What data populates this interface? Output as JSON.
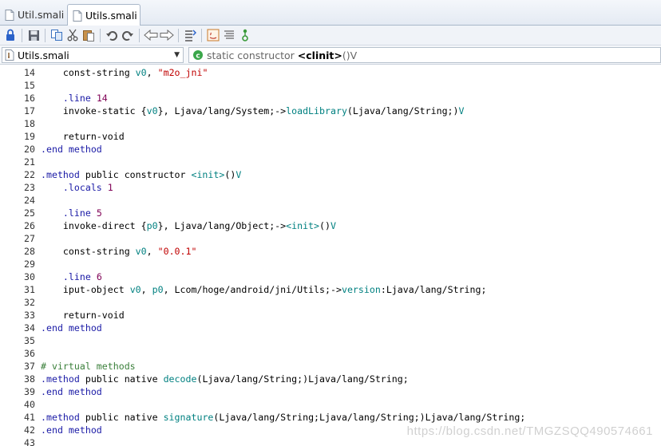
{
  "tabs": [
    {
      "label": "Util.smali",
      "active": false
    },
    {
      "label": "Utils.smali",
      "active": true
    }
  ],
  "toolbar": {
    "buttons": [
      "lock-icon",
      "save-icon",
      "copy-icon",
      "cut-icon",
      "paste-icon",
      "undo-icon",
      "redo-icon",
      "back-icon",
      "forward-icon",
      "outline-icon",
      "java-icon",
      "format-icon",
      "tree-icon"
    ]
  },
  "breadcrumb": {
    "file": "Utils.smali",
    "member_prefix": "static constructor",
    "member_name": "<clinit>",
    "member_suffix": "()V"
  },
  "editor": {
    "lines": [
      {
        "n": "14",
        "tokens": [
          [
            "kw",
            "    const-string "
          ],
          [
            "reg",
            "v0"
          ],
          [
            "kw",
            ", "
          ],
          [
            "str",
            "\"m2o_jni\""
          ]
        ]
      },
      {
        "n": "15",
        "tokens": []
      },
      {
        "n": "16",
        "tokens": [
          [
            "dir",
            "    .line "
          ],
          [
            "num",
            "14"
          ]
        ]
      },
      {
        "n": "17",
        "tokens": [
          [
            "kw",
            "    invoke-static {"
          ],
          [
            "reg",
            "v0"
          ],
          [
            "kw",
            "}, Ljava/lang/System;->"
          ],
          [
            "name",
            "loadLibrary"
          ],
          [
            "kw",
            "(Ljava/lang/String;)"
          ],
          [
            "reg",
            "V"
          ]
        ]
      },
      {
        "n": "18",
        "tokens": []
      },
      {
        "n": "19",
        "tokens": [
          [
            "kw",
            "    return-void"
          ]
        ]
      },
      {
        "n": "20",
        "tokens": [
          [
            "dir",
            ".end method"
          ]
        ]
      },
      {
        "n": "21",
        "tokens": []
      },
      {
        "n": "22",
        "tokens": [
          [
            "dir",
            ".method "
          ],
          [
            "kw",
            "public constructor "
          ],
          [
            "name",
            "<init>"
          ],
          [
            "kw",
            "()"
          ],
          [
            "reg",
            "V"
          ]
        ]
      },
      {
        "n": "23",
        "tokens": [
          [
            "dir",
            "    .locals "
          ],
          [
            "num",
            "1"
          ]
        ]
      },
      {
        "n": "24",
        "tokens": []
      },
      {
        "n": "25",
        "tokens": [
          [
            "dir",
            "    .line "
          ],
          [
            "num",
            "5"
          ]
        ]
      },
      {
        "n": "26",
        "tokens": [
          [
            "kw",
            "    invoke-direct {"
          ],
          [
            "reg",
            "p0"
          ],
          [
            "kw",
            "}, Ljava/lang/Object;->"
          ],
          [
            "name",
            "<init>"
          ],
          [
            "kw",
            "()"
          ],
          [
            "reg",
            "V"
          ]
        ]
      },
      {
        "n": "27",
        "tokens": []
      },
      {
        "n": "28",
        "tokens": [
          [
            "kw",
            "    const-string "
          ],
          [
            "reg",
            "v0"
          ],
          [
            "kw",
            ", "
          ],
          [
            "str",
            "\"0.0.1\""
          ]
        ]
      },
      {
        "n": "29",
        "tokens": []
      },
      {
        "n": "30",
        "tokens": [
          [
            "dir",
            "    .line "
          ],
          [
            "num",
            "6"
          ]
        ]
      },
      {
        "n": "31",
        "tokens": [
          [
            "kw",
            "    iput-object "
          ],
          [
            "reg",
            "v0"
          ],
          [
            "kw",
            ", "
          ],
          [
            "reg",
            "p0"
          ],
          [
            "kw",
            ", Lcom/hoge/android/jni/Utils;->"
          ],
          [
            "name",
            "version"
          ],
          [
            "kw",
            ":Ljava/lang/String;"
          ]
        ]
      },
      {
        "n": "32",
        "tokens": []
      },
      {
        "n": "33",
        "tokens": [
          [
            "kw",
            "    return-void"
          ]
        ]
      },
      {
        "n": "34",
        "tokens": [
          [
            "dir",
            ".end method"
          ]
        ]
      },
      {
        "n": "35",
        "tokens": []
      },
      {
        "n": "36",
        "tokens": []
      },
      {
        "n": "37",
        "tokens": [
          [
            "cm",
            "# virtual methods"
          ]
        ]
      },
      {
        "n": "38",
        "tokens": [
          [
            "dir",
            ".method "
          ],
          [
            "kw",
            "public native "
          ],
          [
            "name",
            "decode"
          ],
          [
            "kw",
            "(Ljava/lang/String;)Ljava/lang/String;"
          ]
        ]
      },
      {
        "n": "39",
        "tokens": [
          [
            "dir",
            ".end method"
          ]
        ]
      },
      {
        "n": "40",
        "tokens": []
      },
      {
        "n": "41",
        "tokens": [
          [
            "dir",
            ".method "
          ],
          [
            "kw",
            "public native "
          ],
          [
            "name",
            "signature"
          ],
          [
            "kw",
            "(Ljava/lang/String;Ljava/lang/String;)Ljava/lang/String;"
          ]
        ]
      },
      {
        "n": "42",
        "tokens": [
          [
            "dir",
            ".end method"
          ]
        ]
      },
      {
        "n": "43",
        "tokens": []
      }
    ]
  },
  "watermark": "https://blog.csdn.net/TMGZSQQ490574661"
}
